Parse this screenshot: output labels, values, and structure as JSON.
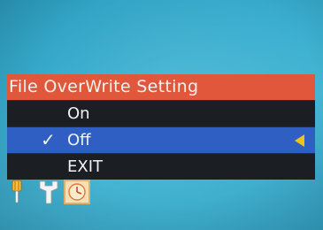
{
  "menu": {
    "title": "File OverWrite Setting",
    "items": [
      {
        "label": "On",
        "checked": false,
        "selected": false
      },
      {
        "label": "Off",
        "checked": true,
        "selected": true
      },
      {
        "label": "EXIT",
        "checked": false,
        "selected": false
      }
    ],
    "check_mark": "✓"
  },
  "icons": [
    {
      "name": "screwdriver-icon"
    },
    {
      "name": "wrench-icon"
    },
    {
      "name": "clock-icon"
    }
  ],
  "colors": {
    "background": "#3aaed0",
    "title_bar": "#e0573c",
    "menu_bg": "#1b1f24",
    "selected_row": "#2f5fc2",
    "arrow": "#f1c21b"
  }
}
